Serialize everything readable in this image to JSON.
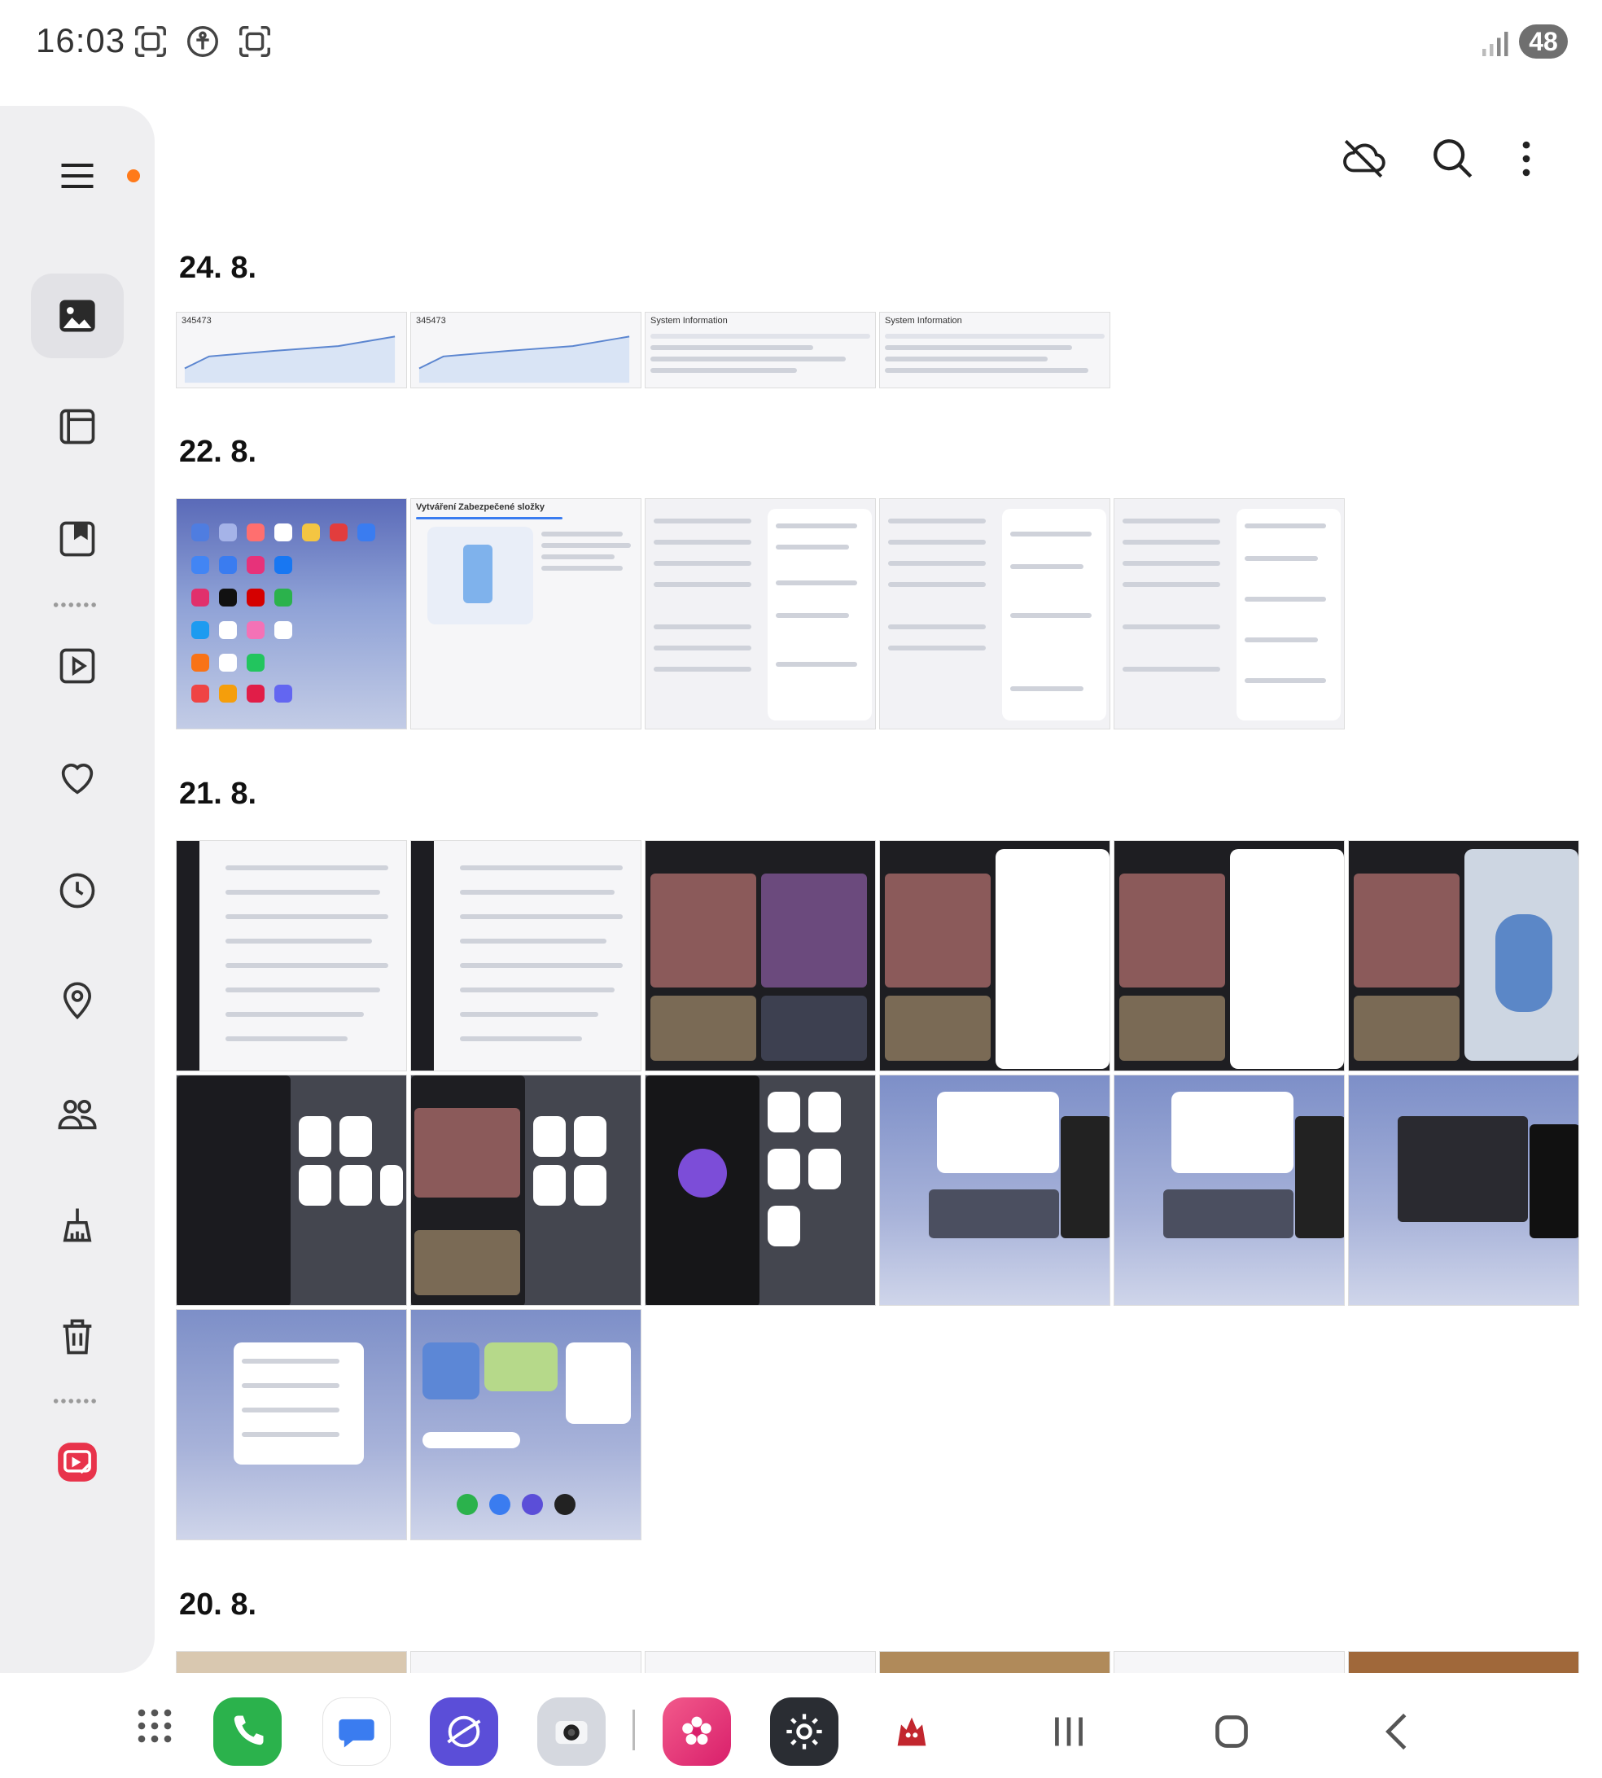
{
  "status_bar": {
    "time": "16:03",
    "battery": "48",
    "icons": [
      "screenshot-icon",
      "accessibility-icon",
      "screenshot-icon"
    ]
  },
  "sidebar": {
    "items": [
      {
        "name": "menu",
        "icon": "hamburger-icon",
        "badge_color": "#ff7a1a"
      },
      {
        "name": "pictures",
        "icon": "image-icon",
        "active": true
      },
      {
        "name": "albums",
        "icon": "album-icon"
      },
      {
        "name": "stories",
        "icon": "bookmark-icon"
      },
      {
        "name": "videos",
        "icon": "play-icon"
      },
      {
        "name": "favorites",
        "icon": "heart-icon"
      },
      {
        "name": "recent",
        "icon": "clock-icon"
      },
      {
        "name": "locations",
        "icon": "location-icon"
      },
      {
        "name": "people",
        "icon": "people-icon"
      },
      {
        "name": "cleanup",
        "icon": "broom-icon"
      },
      {
        "name": "trash",
        "icon": "trash-icon"
      },
      {
        "name": "editor",
        "icon": "photo-editor-icon",
        "color": "#e8334b"
      }
    ]
  },
  "toolbar": {
    "icons": [
      "cloud-off-icon",
      "search-icon",
      "more-vertical-icon"
    ]
  },
  "sections": [
    {
      "date": "24. 8.",
      "thumb_text": [
        "345473",
        "345473",
        "System Information",
        "System Information"
      ]
    },
    {
      "date": "22. 8.",
      "thumb_text": [
        "Vytváření Zabezpečené složky"
      ]
    },
    {
      "date": "21. 8.",
      "thumb_text": []
    },
    {
      "date": "20. 8.",
      "thumb_text": []
    }
  ],
  "dock": {
    "apps": [
      {
        "name": "phone",
        "icon": "phone-icon",
        "color": "#2bb24c"
      },
      {
        "name": "messages",
        "icon": "message-icon",
        "color": "#3a7cf0"
      },
      {
        "name": "internet",
        "icon": "browser-icon",
        "color": "#5b4ed8"
      },
      {
        "name": "camera",
        "icon": "camera-icon",
        "color": "#c9ccd4"
      },
      {
        "name": "gallery",
        "icon": "flower-icon",
        "color": "#e7327a"
      },
      {
        "name": "settings",
        "icon": "gear-icon",
        "color": "#2a2d33"
      },
      {
        "name": "antutu",
        "icon": "antutu-icon",
        "color": "#c2262e"
      }
    ],
    "nav": [
      "recents-icon",
      "home-icon",
      "back-icon"
    ]
  }
}
